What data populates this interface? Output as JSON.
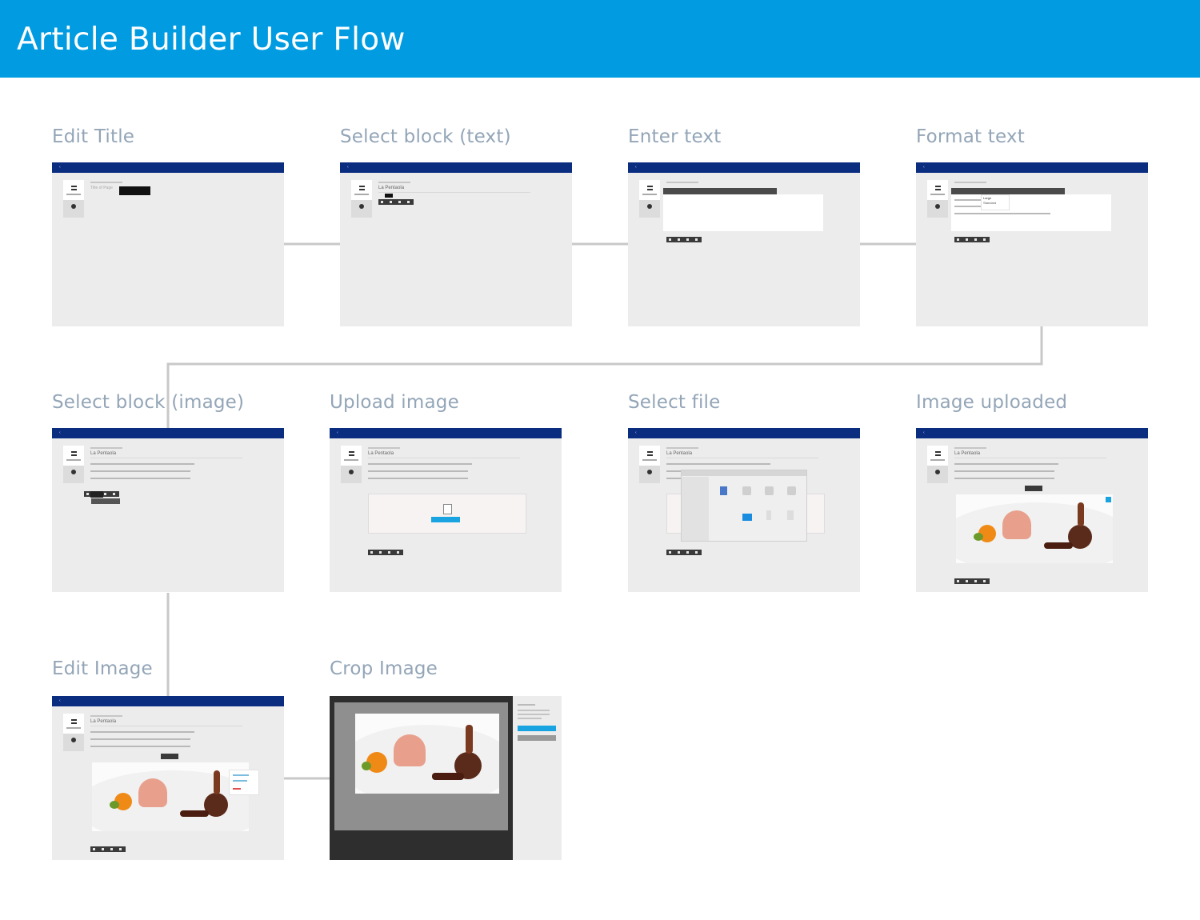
{
  "title": "Article Builder User Flow",
  "colors": {
    "header": "#009be1",
    "title_text": "#ffffff",
    "step_title": "#93a5b7",
    "app_bar": "#0b2d80",
    "connector": "#c8c8c8",
    "thumbnail_bg": "#ececec"
  },
  "steps": [
    {
      "title": "Edit Title"
    },
    {
      "title": "Select block (text)"
    },
    {
      "title": "Enter text"
    },
    {
      "title": "Format text"
    },
    {
      "title": "Select block (image)"
    },
    {
      "title": "Upload image"
    },
    {
      "title": "Select file"
    },
    {
      "title": "Image uploaded"
    },
    {
      "title": "Edit Image"
    },
    {
      "title": "Crop Image"
    }
  ],
  "mock": {
    "page_title": "La Pentaola",
    "placeholder_title": "Title of Page",
    "format_options": [
      "Large",
      "Standard"
    ]
  },
  "flow": [
    [
      "Edit Title",
      "Select block (text)"
    ],
    [
      "Select block (text)",
      "Enter text"
    ],
    [
      "Enter text",
      "Format text"
    ],
    [
      "Format text",
      "Select block (image)"
    ],
    [
      "Select block (image)",
      "Edit Image"
    ],
    [
      "Edit Image",
      "Crop Image"
    ]
  ]
}
